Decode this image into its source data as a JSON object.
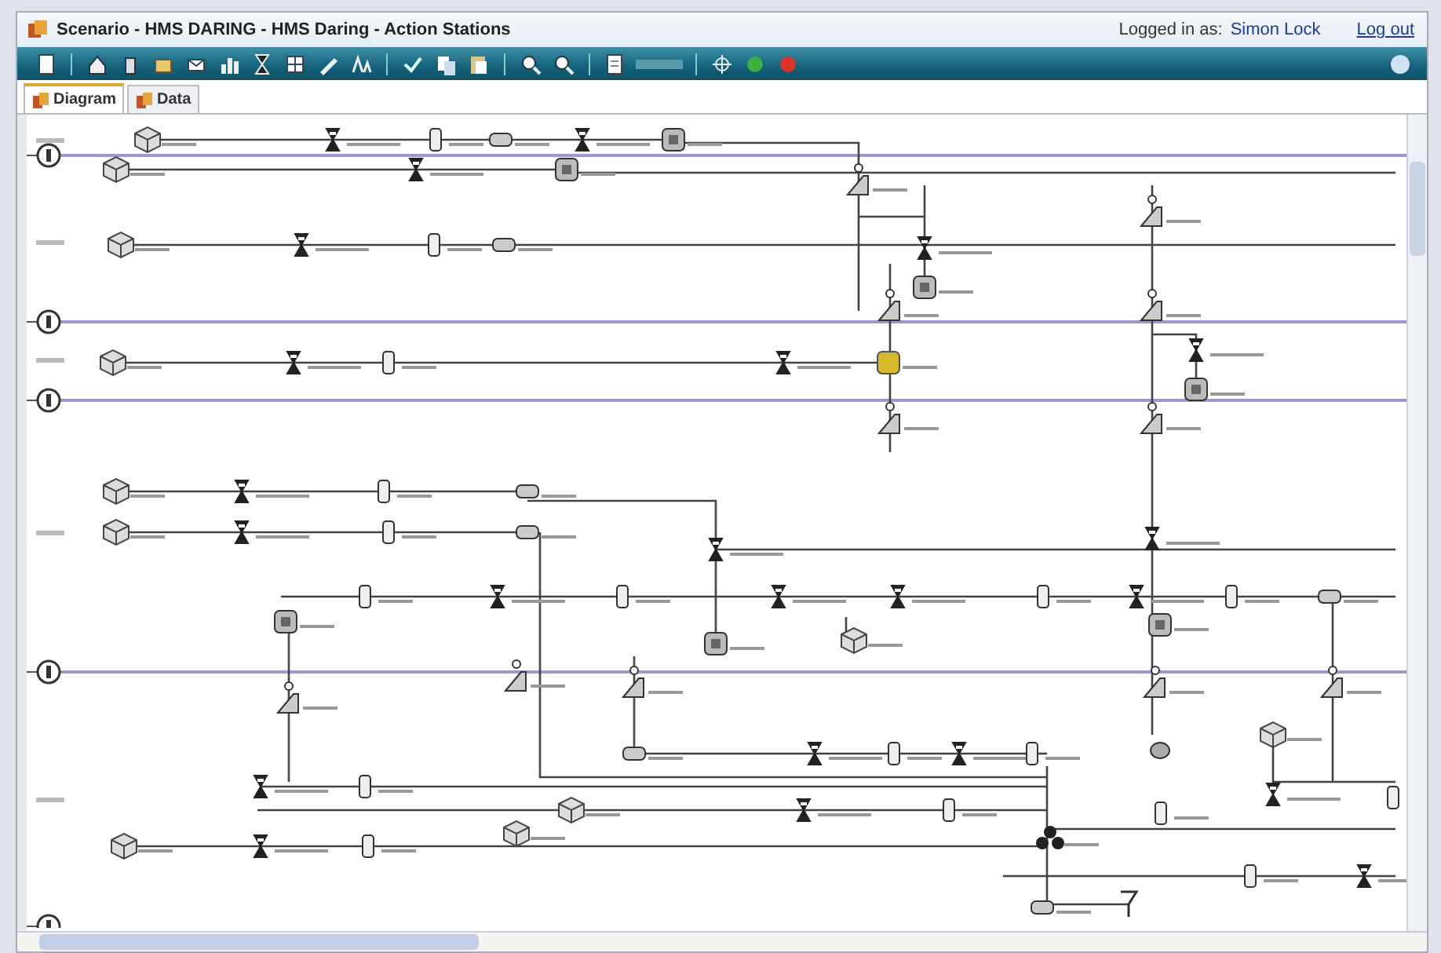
{
  "window": {
    "title": "Scenario - HMS DARING - HMS Daring - Action Stations"
  },
  "user": {
    "label": "Logged in as:",
    "name": "Simon Lock",
    "logout": "Log out"
  },
  "tabs": [
    {
      "label": "Diagram",
      "selected": true
    },
    {
      "label": "Data",
      "selected": false
    }
  ]
}
